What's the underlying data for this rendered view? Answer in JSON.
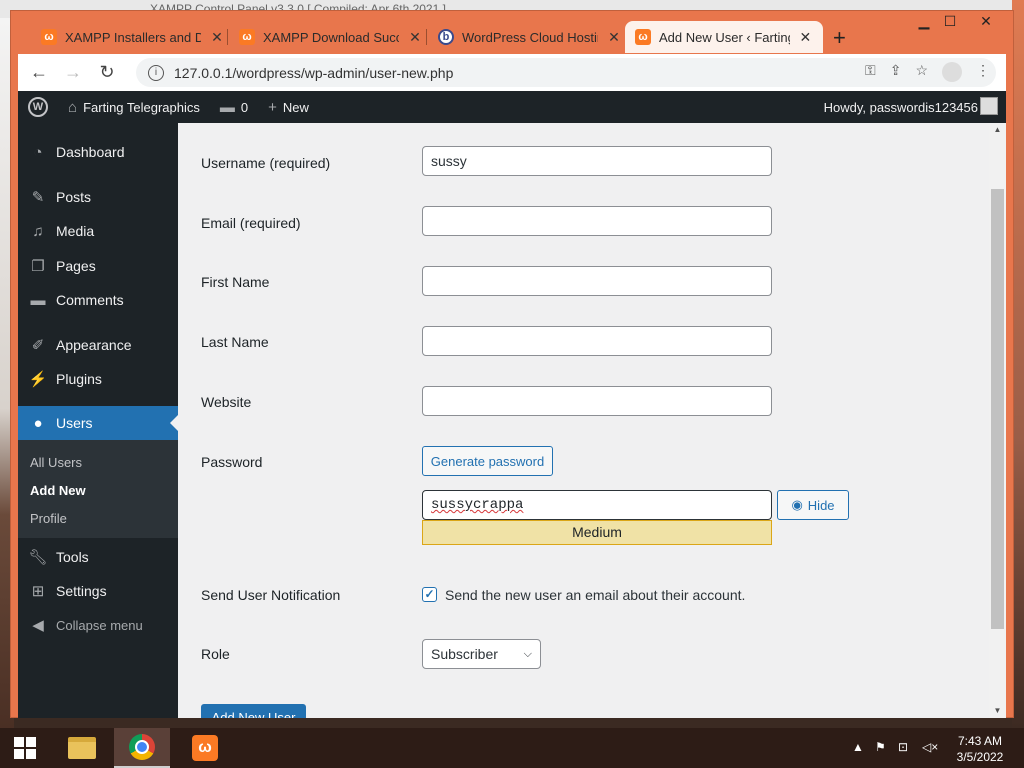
{
  "background": {
    "behind_window_title": "XAMPP Control Panel v3.3.0   [ Compiled: Apr 6th 2021 ]"
  },
  "browser": {
    "tabs": [
      {
        "label": "XAMPP Installers and Do",
        "icon": "xampp-icon",
        "active": false
      },
      {
        "label": "XAMPP Download Succe",
        "icon": "xampp-icon",
        "active": false
      },
      {
        "label": "WordPress Cloud Hosting",
        "icon": "wordpress-hosting-icon",
        "active": false
      },
      {
        "label": "Add New User ‹ Farting T",
        "icon": "xampp-icon",
        "active": true
      }
    ],
    "close_glyph": "✕",
    "new_tab_glyph": "+",
    "window_controls": {
      "minimize": "▁",
      "maximize": "☐",
      "close": "✕"
    },
    "url": "127.0.0.1/wordpress/wp-admin/user-new.php"
  },
  "adminbar": {
    "site_name": "Farting Telegraphics",
    "comments_count": "0",
    "new_label": "New",
    "howdy": "Howdy, passwordis123456"
  },
  "sidebar": {
    "items": [
      {
        "label": "Dashboard",
        "icon": "dashboard-icon"
      },
      {
        "label": "Posts",
        "icon": "pin-icon"
      },
      {
        "label": "Media",
        "icon": "media-icon"
      },
      {
        "label": "Pages",
        "icon": "pages-icon"
      },
      {
        "label": "Comments",
        "icon": "comment-icon"
      },
      {
        "label": "Appearance",
        "icon": "paintbrush-icon"
      },
      {
        "label": "Plugins",
        "icon": "plugin-icon"
      },
      {
        "label": "Users",
        "icon": "user-icon"
      },
      {
        "label": "Tools",
        "icon": "wrench-icon"
      },
      {
        "label": "Settings",
        "icon": "settings-icon"
      }
    ],
    "submenu": [
      "All Users",
      "Add New",
      "Profile"
    ],
    "collapse_label": "Collapse menu"
  },
  "form": {
    "username_label": "Username",
    "required_text": "(required)",
    "username_value": "sussy",
    "email_label": "Email",
    "email_value": "",
    "first_name_label": "First Name",
    "first_name_value": "",
    "last_name_label": "Last Name",
    "last_name_value": "",
    "website_label": "Website",
    "website_value": "",
    "password_label": "Password",
    "generate_label": "Generate password",
    "password_value": "sussycrappa",
    "hide_label": "Hide",
    "strength": "Medium",
    "notification_label": "Send User Notification",
    "notification_text": "Send the new user an email about their account.",
    "notification_checked": true,
    "role_label": "Role",
    "role_value": "Subscriber",
    "submit_label": "Add New User"
  },
  "taskbar": {
    "time": "7:43 AM",
    "date": "3/5/2022"
  },
  "colors": {
    "accent": "#2271b1",
    "admin_dark": "#1d2327",
    "chrome_frame": "#e8764c",
    "strength_medium": "#f0e2a6"
  }
}
